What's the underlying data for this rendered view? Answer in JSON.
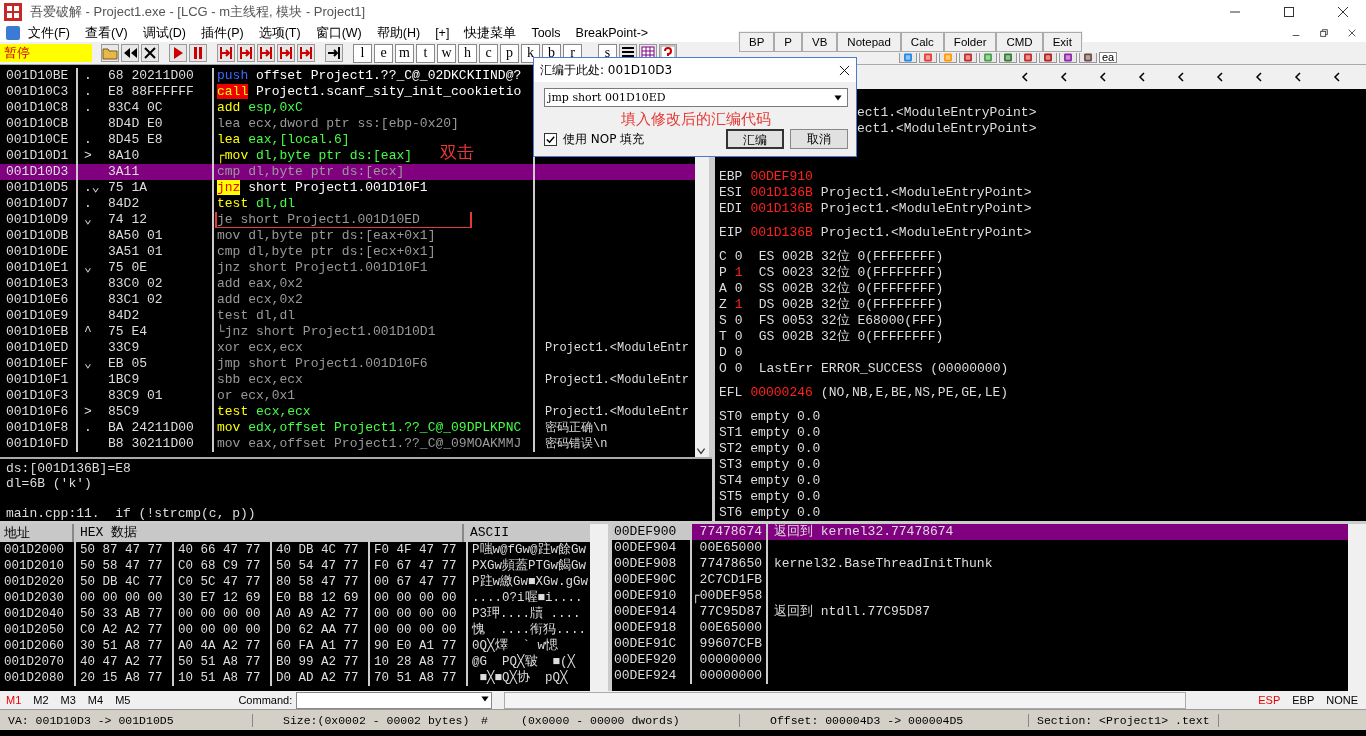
{
  "window": {
    "title": "吾爱破解 - Project1.exe - [LCG - m主线程, 模块 - Project1]"
  },
  "menu": [
    "文件(F)",
    "查看(V)",
    "调试(D)",
    "插件(P)",
    "选项(T)",
    "窗口(W)",
    "帮助(H)",
    "[+]",
    "快捷菜单",
    "Tools",
    "BreakPoint->"
  ],
  "toolbar": {
    "status": "暂停",
    "letters": [
      "l",
      "e",
      "m",
      "t",
      "w",
      "h",
      "c",
      "p",
      "k",
      "b",
      "r",
      "s"
    ],
    "tail_label": "ea"
  },
  "quick_buttons": [
    "BP",
    "P",
    "VB",
    "Notepad",
    "Calc",
    "Folder",
    "CMD",
    "Exit"
  ],
  "disasm": [
    {
      "address": "001D10BE",
      "mark": ".",
      "hex": "68 20211D00",
      "mnemonic": "push",
      "operands": "offset Project1.??_C@_02DKCKIIND@?",
      "kind": "push",
      "selected": false,
      "boxed": false
    },
    {
      "address": "001D10C3",
      "mark": ".",
      "hex": "E8 88FFFFFF",
      "mnemonic": "call",
      "operands": "Project1.scanf_sity_init_cookietio",
      "kind": "call",
      "selected": false,
      "boxed": false
    },
    {
      "address": "001D10C8",
      "mark": ".",
      "hex": "83C4 0C",
      "mnemonic": "add",
      "operands": "esp,0xC",
      "kind": "plain",
      "selected": false,
      "boxed": false
    },
    {
      "address": "001D10CB",
      "hex": "8D4D E0",
      "mnemonic": "lea",
      "operands": "ecx,dword ptr ss:[ebp-0x20]",
      "kind": "gray",
      "selected": false,
      "boxed": false
    },
    {
      "address": "001D10CE",
      "mark": ".",
      "hex": "8D45 E8",
      "mnemonic": "lea",
      "operands": "eax,[local.6]",
      "kind": "plain",
      "selected": false,
      "boxed": false
    },
    {
      "address": "001D10D1",
      "mark": ">",
      "hex": "8A10",
      "mnemonic": "┌mov",
      "operands": "dl,byte ptr ds:[eax]",
      "kind": "plain",
      "selected": false,
      "boxed": false
    },
    {
      "address": "001D10D3",
      "hex": "3A11",
      "mnemonic": "cmp",
      "operands": "dl,byte ptr ds:[ecx]",
      "kind": "gray",
      "selected": true,
      "boxed": false
    },
    {
      "address": "001D10D5",
      "mark": ".⌄",
      "hex": "75 1A",
      "mnemonic": "jnz",
      "operands": "short Project1.001D10F1",
      "kind": "jump",
      "selected": false,
      "boxed": false
    },
    {
      "address": "001D10D7",
      "mark": ".",
      "hex": "84D2",
      "mnemonic": "test",
      "operands": "dl,dl",
      "kind": "plain",
      "selected": false,
      "boxed": false
    },
    {
      "address": "001D10D9",
      "mark": "⌄",
      "hex": "74 12",
      "mnemonic": "je",
      "operands": "short Project1.001D10ED",
      "kind": "gray",
      "selected": false,
      "boxed": true
    },
    {
      "address": "001D10DB",
      "hex": "8A50 01",
      "mnemonic": "mov",
      "operands": "dl,byte ptr ds:[eax+0x1]",
      "kind": "gray",
      "selected": false,
      "boxed": false
    },
    {
      "address": "001D10DE",
      "hex": "3A51 01",
      "mnemonic": "cmp",
      "operands": "dl,byte ptr ds:[ecx+0x1]",
      "kind": "gray",
      "selected": false,
      "boxed": false
    },
    {
      "address": "001D10E1",
      "mark": "⌄",
      "hex": "75 0E",
      "mnemonic": "jnz",
      "operands": "short Project1.001D10F1",
      "kind": "gray",
      "selected": false,
      "boxed": false
    },
    {
      "address": "001D10E3",
      "hex": "83C0 02",
      "mnemonic": "add",
      "operands": "eax,0x2",
      "kind": "gray",
      "selected": false,
      "boxed": false
    },
    {
      "address": "001D10E6",
      "hex": "83C1 02",
      "mnemonic": "add",
      "operands": "ecx,0x2",
      "kind": "gray",
      "selected": false,
      "boxed": false
    },
    {
      "address": "001D10E9",
      "hex": "84D2",
      "mnemonic": "test",
      "operands": "dl,dl",
      "kind": "gray",
      "selected": false,
      "boxed": false
    },
    {
      "address": "001D10EB",
      "mark": "^",
      "hex": "75 E4",
      "mnemonic": "└jnz",
      "operands": "short Project1.001D10D1",
      "kind": "gray",
      "selected": false,
      "boxed": false
    },
    {
      "address": "001D10ED",
      "hex": "33C9",
      "mnemonic": "xor",
      "operands": "ecx,ecx",
      "comment": "Project1.<ModuleEntr",
      "kind": "gray",
      "selected": false,
      "boxed": false
    },
    {
      "address": "001D10EF",
      "mark": "⌄",
      "hex": "EB 05",
      "mnemonic": "jmp",
      "operands": "short Project1.001D10F6",
      "kind": "gray",
      "selected": false,
      "boxed": false
    },
    {
      "address": "001D10F1",
      "hex": "1BC9",
      "mnemonic": "sbb",
      "operands": "ecx,ecx",
      "comment": "Project1.<ModuleEntr",
      "kind": "gray",
      "selected": false,
      "boxed": false
    },
    {
      "address": "001D10F3",
      "hex": "83C9 01",
      "mnemonic": "or",
      "operands": "ecx,0x1",
      "kind": "gray",
      "selected": false,
      "boxed": false
    },
    {
      "address": "001D10F6",
      "mark": ">",
      "hex": "85C9",
      "mnemonic": "test",
      "operands": "ecx,ecx",
      "comment": "Project1.<ModuleEntr",
      "kind": "plain",
      "selected": false,
      "boxed": false
    },
    {
      "address": "001D10F8",
      "mark": ".",
      "hex": "BA 24211D00",
      "mnemonic": "mov",
      "operands": "edx,offset Project1.??_C@_09DPLKPNC",
      "comment": "密码正确\\n",
      "kind": "plain",
      "selected": false,
      "boxed": false
    },
    {
      "address": "001D10FD",
      "hex": "B8 30211D00",
      "mnemonic": "mov",
      "operands": "eax,offset Project1.??_C@_09MOAKMMJ",
      "comment": "密码错误\\n",
      "kind": "gray",
      "selected": false,
      "boxed": false
    }
  ],
  "annotations": {
    "double_click": "双击",
    "dialog_hint": "填入修改后的汇编代码"
  },
  "info_pane": {
    "lines": [
      "ds:[001D136B]=E8",
      "dl=6B ('k')"
    ],
    "source": "main.cpp:11.  if (!strcmp(c, p))"
  },
  "assemble_dialog": {
    "title": "汇编于此处: 001D10D3",
    "value": "jmp short 001D10ED",
    "nop_fill": {
      "label": "使用 NOP 填充",
      "checked": true
    },
    "buttons": [
      "汇编",
      "取消"
    ]
  },
  "registers": {
    "cut_lines": [
      "ect1.<ModuleEntryPoint>",
      "ect1.<ModuleEntryPoint>"
    ],
    "general": [
      {
        "name": "EBP",
        "value": "00DEF910",
        "changed": true
      },
      {
        "name": "ESI",
        "value": "001D136B",
        "changed": true,
        "comment": "Project1.<ModuleEntryPoint>"
      },
      {
        "name": "EDI",
        "value": "001D136B",
        "changed": true,
        "comment": "Project1.<ModuleEntryPoint>"
      }
    ],
    "eip": {
      "name": "EIP",
      "value": "001D136B",
      "changed": true,
      "comment": "Project1.<ModuleEntryPoint>"
    },
    "flags": [
      {
        "flag": "C",
        "value": "0",
        "changed": false,
        "segment": "ES 002B 32位 0(FFFFFFFF)"
      },
      {
        "flag": "P",
        "value": "1",
        "changed": true,
        "segment": "CS 0023 32位 0(FFFFFFFF)"
      },
      {
        "flag": "A",
        "value": "0",
        "changed": false,
        "segment": "SS 002B 32位 0(FFFFFFFF)"
      },
      {
        "flag": "Z",
        "value": "1",
        "changed": true,
        "segment": "DS 002B 32位 0(FFFFFFFF)"
      },
      {
        "flag": "S",
        "value": "0",
        "changed": false,
        "segment": "FS 0053 32位 E68000(FFF)"
      },
      {
        "flag": "T",
        "value": "0",
        "changed": false,
        "segment": "GS 002B 32位 0(FFFFFFFF)"
      },
      {
        "flag": "D",
        "value": "0",
        "changed": false
      },
      {
        "flag": "O",
        "value": "0",
        "changed": false,
        "segment": "LastErr ERROR_SUCCESS (00000000)"
      }
    ],
    "efl": {
      "name": "EFL",
      "value": "00000246",
      "changed": true,
      "comment": "(NO,NB,E,BE,NS,PE,GE,LE)"
    },
    "fpu": [
      "ST0 empty 0.0",
      "ST1 empty 0.0",
      "ST2 empty 0.0",
      "ST3 empty 0.0",
      "ST4 empty 0.0",
      "ST5 empty 0.0",
      "ST6 empty 0.0"
    ]
  },
  "dump": {
    "columns": [
      "地址",
      "HEX 数据",
      "ASCII"
    ],
    "rows": [
      {
        "address": "001D2000",
        "hex": [
          "50 87 47 77",
          "40 66 47 77",
          "40 DB 4C 77",
          "F0 4F 47 77"
        ],
        "ascii": "P嗤w@fGw@跓w餘Gw"
      },
      {
        "address": "001D2010",
        "hex": [
          "50 58 47 77",
          "C0 68 C9 77",
          "50 54 47 77",
          "F0 67 47 77"
        ],
        "ascii": "PXGw頻蓋PTGw餲Gw"
      },
      {
        "address": "001D2020",
        "hex": [
          "50 DB 4C 77",
          "C0 5C 47 77",
          "80 58 47 77",
          "00 67 47 77"
        ],
        "ascii": "P跓w繳Gw■XGw.gGw"
      },
      {
        "address": "001D2030",
        "hex": [
          "00 00 00 00",
          "30 E7 12 69",
          "E0 B8 12 69",
          "00 00 00 00"
        ],
        "ascii": "....0?i喔■i...."
      },
      {
        "address": "001D2040",
        "hex": [
          "50 33 AB 77",
          "00 00 00 00",
          "A0 A9 A2 77",
          "00 00 00 00"
        ],
        "ascii": "P3玾....牘 ...."
      },
      {
        "address": "001D2050",
        "hex": [
          "C0 A2 A2 77",
          "00 00 00 00",
          "D0 62 AA 77",
          "00 00 00 00"
        ],
        "ascii": "愧  ....衔犸...."
      },
      {
        "address": "001D2060",
        "hex": [
          "30 51 A8 77",
          "A0 4A A2 77",
          "60 FA A1 77",
          "90 E0 A1 77"
        ],
        "ascii": "0Q╳燡  ` w愢"
      },
      {
        "address": "001D2070",
        "hex": [
          "40 47 A2 77",
          "50 51 A8 77",
          "B0 99 A2 77",
          "10 28 A8 77"
        ],
        "ascii": "@G  PQ╳皲  ■(╳"
      },
      {
        "address": "001D2080",
        "hex": [
          "20 15 A8 77",
          "10 51 A8 77",
          "D0 AD A2 77",
          "70 51 A8 77"
        ],
        "ascii": " ■╳■Q╳协  pQ╳"
      }
    ]
  },
  "stack": [
    {
      "address": "00DEF900",
      "value": "77478674",
      "comment": "返回到 kernel32.77478674",
      "selected": true
    },
    {
      "address": "00DEF904",
      "value": "00E65000",
      "selected": false
    },
    {
      "address": "00DEF908",
      "value": "77478650",
      "comment": "kernel32.BaseThreadInitThunk",
      "selected": false
    },
    {
      "address": "00DEF90C",
      "value": "2C7CD1FB",
      "selected": false
    },
    {
      "address": "00DEF910",
      "value": "┌00DEF958",
      "selected": false
    },
    {
      "address": "00DEF914",
      "value": "77C95D87",
      "comment": "返回到 ntdll.77C95D87",
      "selected": false
    },
    {
      "address": "00DEF918",
      "value": "00E65000",
      "selected": false
    },
    {
      "address": "00DEF91C",
      "value": "99607CFB",
      "selected": false
    },
    {
      "address": "00DEF920",
      "value": "00000000",
      "selected": false
    },
    {
      "address": "00DEF924",
      "value": "00000000",
      "selected": false
    }
  ],
  "command_bar": {
    "marks": [
      {
        "label": "M1",
        "selected": true
      },
      {
        "label": "M2",
        "selected": false
      },
      {
        "label": "M3",
        "selected": false
      },
      {
        "label": "M4",
        "selected": false
      },
      {
        "label": "M5",
        "selected": false
      }
    ],
    "label": "Command:",
    "modes": [
      {
        "label": "ESP",
        "selected": true
      },
      {
        "label": "EBP",
        "selected": false
      },
      {
        "label": "NONE",
        "selected": false
      }
    ]
  },
  "status_bar": [
    "VA: 001D10D3 -> 001D10D5",
    "Size:(0x0002 - 00002 bytes)",
    "#",
    "(0x0000 - 00000 dwords)",
    "Offset: 000004D3 -> 000004D5",
    "Section: <Project1> .text"
  ]
}
